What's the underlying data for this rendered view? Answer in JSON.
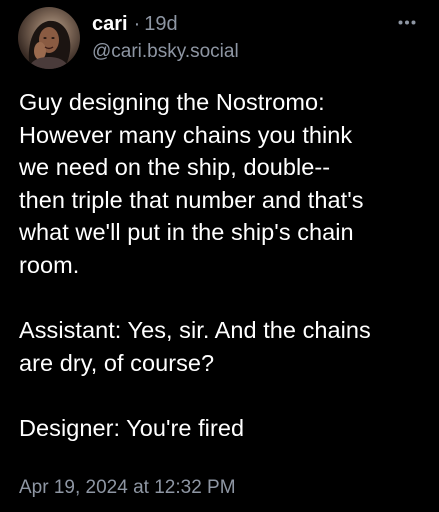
{
  "author": {
    "display_name": "cari",
    "separator": "·",
    "age": "19d",
    "handle": "@cari.bsky.social",
    "avatar_icon": "user-avatar"
  },
  "post": {
    "text": "Guy designing the Nostromo:\nHowever many chains you think\nwe need on the ship, double--\nthen triple that number and that's\nwhat we'll put in the ship's chain\nroom.\n\nAssistant: Yes, sir. And the chains\nare dry, of course?\n\nDesigner: You're fired",
    "timestamp": "Apr 19, 2024 at 12:32 PM"
  },
  "menu": {
    "icon": "more-horizontal-icon"
  },
  "colors": {
    "background": "#000000",
    "text": "#ffffff",
    "muted": "#8e96a3"
  }
}
